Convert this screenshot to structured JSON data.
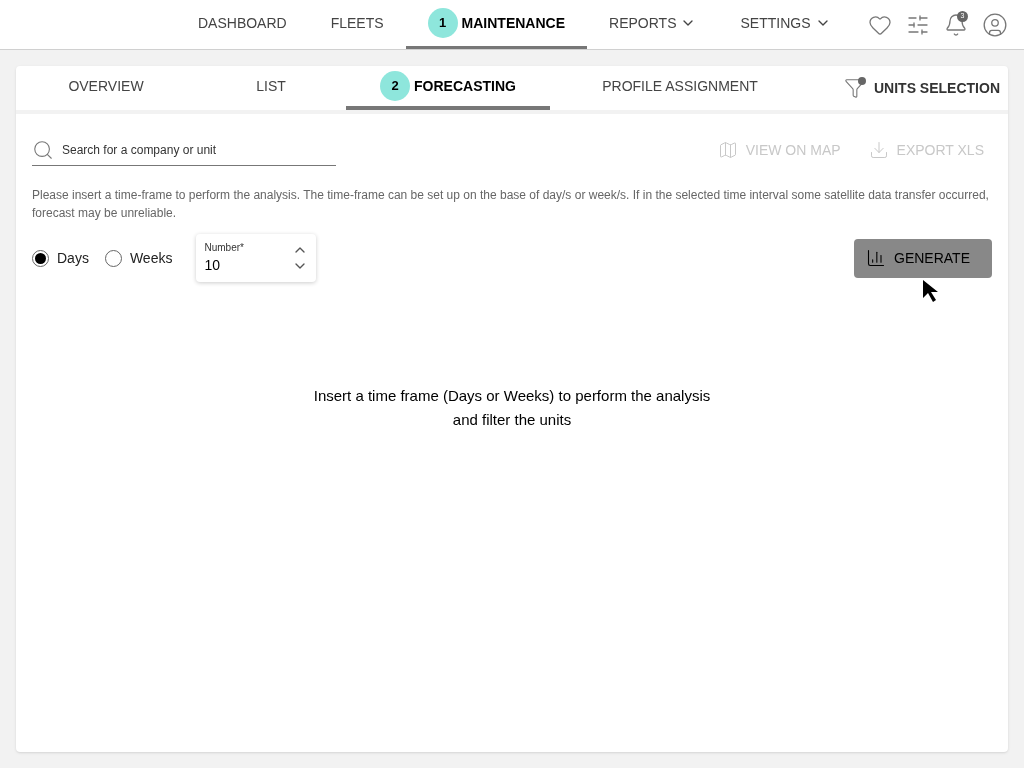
{
  "nav": {
    "items": [
      {
        "label": "DASHBOARD",
        "selected": false,
        "dropdown": false
      },
      {
        "label": "FLEETS",
        "selected": false,
        "dropdown": false
      },
      {
        "label": "MAINTENANCE",
        "selected": true,
        "dropdown": false,
        "step": "1"
      },
      {
        "label": "REPORTS",
        "selected": false,
        "dropdown": true
      },
      {
        "label": "SETTINGS",
        "selected": false,
        "dropdown": true
      }
    ],
    "notification_count": "3"
  },
  "tabs": [
    {
      "label": "OVERVIEW",
      "selected": false
    },
    {
      "label": "LIST",
      "selected": false
    },
    {
      "label": "FORECASTING",
      "selected": true,
      "step": "2"
    },
    {
      "label": "PROFILE ASSIGNMENT",
      "selected": false
    }
  ],
  "units_selection": {
    "label": "UNITS SELECTION"
  },
  "search": {
    "placeholder": "Search for a company or unit"
  },
  "actions": [
    {
      "label": "VIEW ON MAP",
      "kind": "map",
      "disabled": true
    },
    {
      "label": "EXPORT XLS",
      "kind": "export",
      "disabled": true
    }
  ],
  "info": "Please insert a time-frame to perform the analysis. The time-frame can be set up on the base of day/s or week/s. If in the selected time interval some satellite data transfer occurred, forecast may be unreliable.",
  "period": [
    {
      "label": "Days",
      "selected": true
    },
    {
      "label": "Weeks",
      "selected": false
    }
  ],
  "number": {
    "label": "Number*",
    "value": "10"
  },
  "generate": {
    "label": "GENERATE"
  },
  "empty_message": [
    "Insert a time frame (Days or Weeks) to perform the analysis",
    "and filter the units"
  ]
}
